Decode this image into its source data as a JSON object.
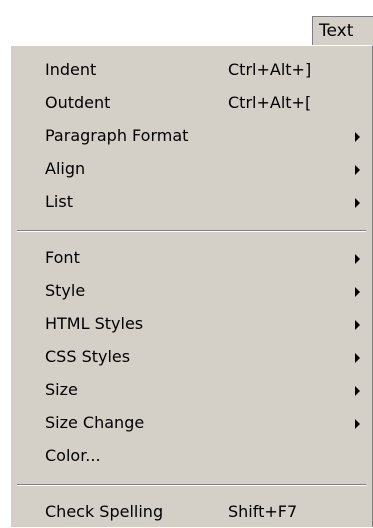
{
  "menubar": {
    "text_label": "Text"
  },
  "menu": {
    "items": [
      {
        "label": "Indent",
        "shortcut": "Ctrl+Alt+]"
      },
      {
        "label": "Outdent",
        "shortcut": "Ctrl+Alt+["
      },
      {
        "label": "Paragraph Format",
        "submenu": true
      },
      {
        "label": "Align",
        "submenu": true
      },
      {
        "label": "List",
        "submenu": true
      },
      {
        "label": "Font",
        "submenu": true
      },
      {
        "label": "Style",
        "submenu": true
      },
      {
        "label": "HTML Styles",
        "submenu": true
      },
      {
        "label": "CSS Styles",
        "submenu": true
      },
      {
        "label": "Size",
        "submenu": true
      },
      {
        "label": "Size Change",
        "submenu": true
      },
      {
        "label": "Color..."
      },
      {
        "label": "Check Spelling",
        "shortcut": "Shift+F7"
      }
    ]
  },
  "colors": {
    "menu_background": "#d4d0c8",
    "separator_dark": "#808080",
    "separator_light": "#ffffff",
    "text": "#000000"
  }
}
